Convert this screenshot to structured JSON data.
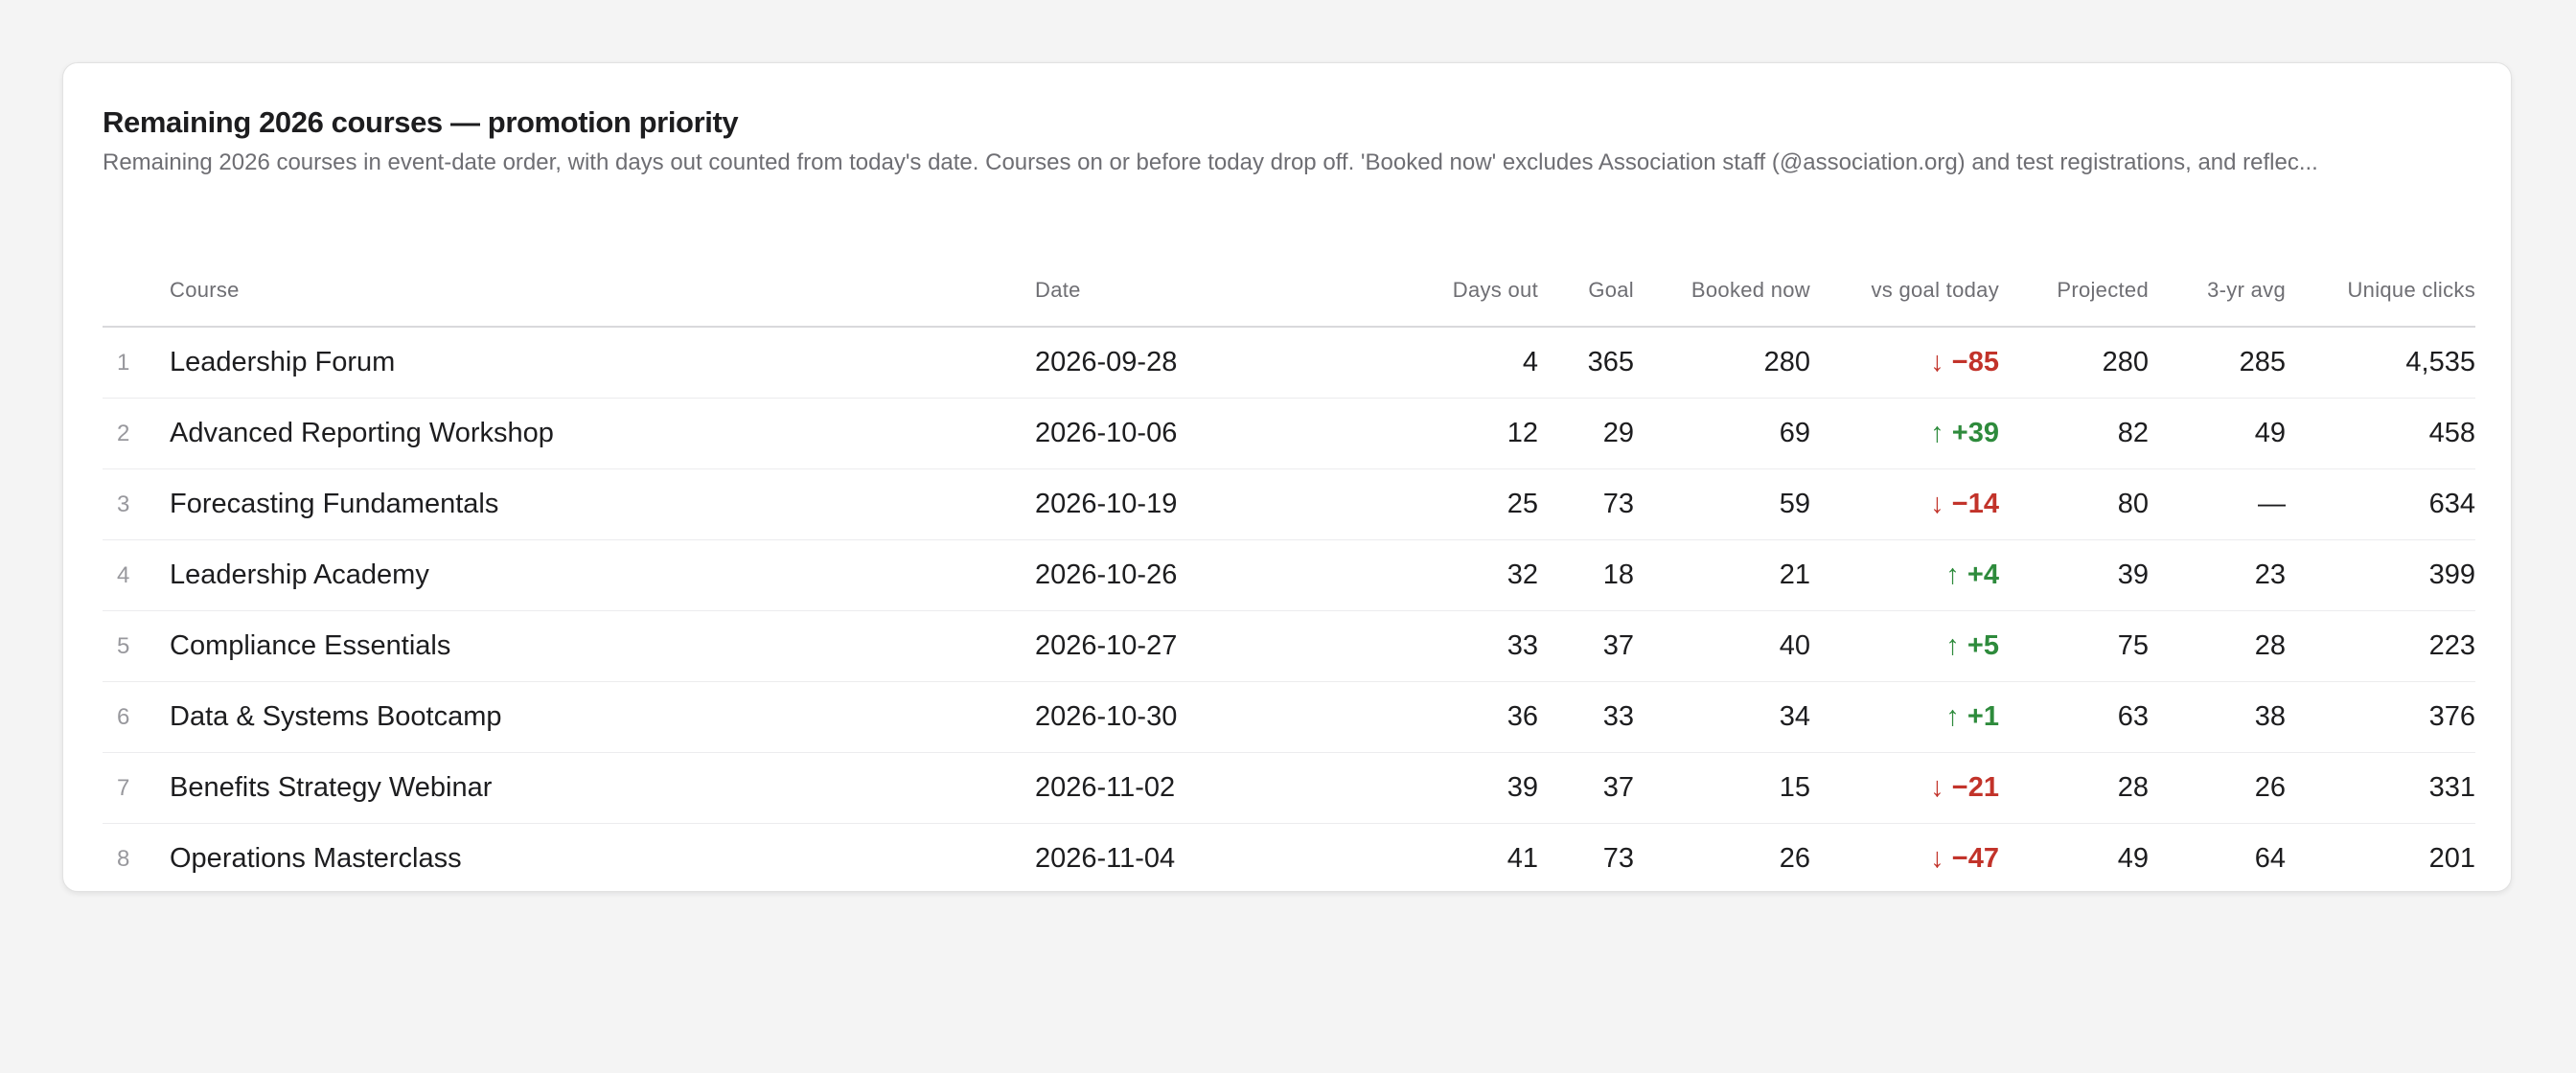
{
  "card": {
    "title": "Remaining 2026 courses — promotion priority",
    "subtitle": "Remaining 2026 courses in event-date order, with days out counted from today's date. Courses on or before today drop off. 'Booked now' excludes Association staff (@association.org) and test registrations, and reflec..."
  },
  "table": {
    "headers": {
      "index": "",
      "course": "Course",
      "date": "Date",
      "days_out": "Days out",
      "goal": "Goal",
      "booked_now": "Booked now",
      "vs_goal": "vs goal today",
      "projected": "Projected",
      "avg3": "3-yr avg",
      "unique_clicks": "Unique clicks"
    },
    "rows": [
      {
        "index": "1",
        "course": "Leadership Forum",
        "date": "2026-09-28",
        "days_out": "4",
        "goal": "365",
        "booked_now": "280",
        "arrow": "↓",
        "direction": "down",
        "vs_goal": "−85",
        "projected": "280",
        "avg3": "285",
        "unique_clicks": "4,535"
      },
      {
        "index": "2",
        "course": "Advanced Reporting Workshop",
        "date": "2026-10-06",
        "days_out": "12",
        "goal": "29",
        "booked_now": "69",
        "arrow": "↑",
        "direction": "up",
        "vs_goal": "+39",
        "projected": "82",
        "avg3": "49",
        "unique_clicks": "458"
      },
      {
        "index": "3",
        "course": "Forecasting Fundamentals",
        "date": "2026-10-19",
        "days_out": "25",
        "goal": "73",
        "booked_now": "59",
        "arrow": "↓",
        "direction": "down",
        "vs_goal": "−14",
        "projected": "80",
        "avg3": "—",
        "unique_clicks": "634"
      },
      {
        "index": "4",
        "course": "Leadership Academy",
        "date": "2026-10-26",
        "days_out": "32",
        "goal": "18",
        "booked_now": "21",
        "arrow": "↑",
        "direction": "up",
        "vs_goal": "+4",
        "projected": "39",
        "avg3": "23",
        "unique_clicks": "399"
      },
      {
        "index": "5",
        "course": "Compliance Essentials",
        "date": "2026-10-27",
        "days_out": "33",
        "goal": "37",
        "booked_now": "40",
        "arrow": "↑",
        "direction": "up",
        "vs_goal": "+5",
        "projected": "75",
        "avg3": "28",
        "unique_clicks": "223"
      },
      {
        "index": "6",
        "course": "Data & Systems Bootcamp",
        "date": "2026-10-30",
        "days_out": "36",
        "goal": "33",
        "booked_now": "34",
        "arrow": "↑",
        "direction": "up",
        "vs_goal": "+1",
        "projected": "63",
        "avg3": "38",
        "unique_clicks": "376"
      },
      {
        "index": "7",
        "course": "Benefits Strategy Webinar",
        "date": "2026-11-02",
        "days_out": "39",
        "goal": "37",
        "booked_now": "15",
        "arrow": "↓",
        "direction": "down",
        "vs_goal": "−21",
        "projected": "28",
        "avg3": "26",
        "unique_clicks": "331"
      },
      {
        "index": "8",
        "course": "Operations Masterclass",
        "date": "2026-11-04",
        "days_out": "41",
        "goal": "73",
        "booked_now": "26",
        "arrow": "↓",
        "direction": "down",
        "vs_goal": "−47",
        "projected": "49",
        "avg3": "64",
        "unique_clicks": "201"
      }
    ]
  },
  "colors": {
    "up": "#2e8b3c",
    "down": "#c2332a",
    "background": "#f4f4f4",
    "card": "#ffffff"
  },
  "icons": {
    "up": "arrow-up-icon",
    "down": "arrow-down-icon"
  }
}
